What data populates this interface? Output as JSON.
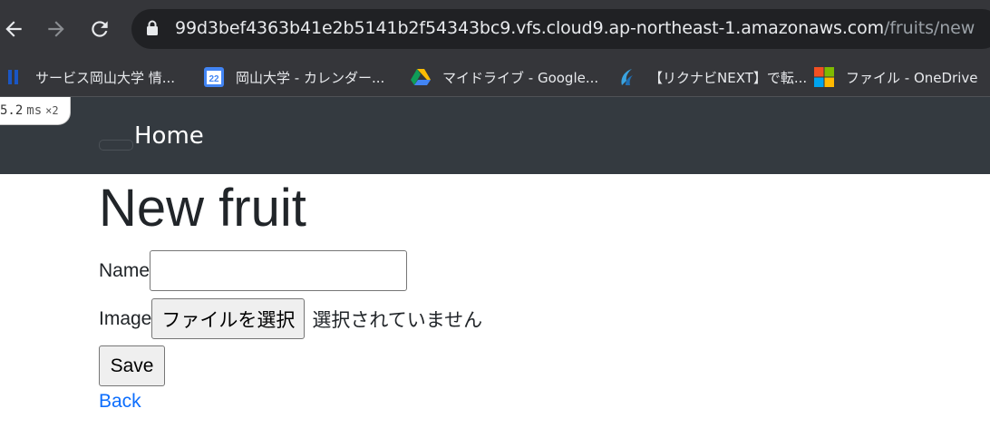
{
  "browser": {
    "url_host": "99d3bef4363b41e2b5141b2f54343bc9.vfs.cloud9.ap-northeast-1.amazonaws.com",
    "url_path": "/fruits/new",
    "bookmarks": [
      {
        "label": "サービス岡山大学 情...",
        "icon": "okayama-univ-icon"
      },
      {
        "label": "岡山大学 - カレンダー...",
        "icon": "google-calendar-icon",
        "icon_text": "22"
      },
      {
        "label": "マイドライブ - Google...",
        "icon": "google-drive-icon"
      },
      {
        "label": "【リクナビNEXT】で転...",
        "icon": "rikunabi-icon"
      },
      {
        "label": "ファイル - OneDrive",
        "icon": "microsoft-icon"
      }
    ]
  },
  "debug": {
    "time": "5.2",
    "unit": "ms",
    "count": "×2"
  },
  "navbar": {
    "home_label": "Home"
  },
  "page": {
    "title": "New fruit",
    "name_label": "Name",
    "name_value": "",
    "image_label": "Image",
    "file_button": "ファイルを選択",
    "file_status": "選択されていません",
    "save_label": "Save",
    "back_label": "Back"
  },
  "colors": {
    "navbar": "#343a40",
    "link": "#0d6efd",
    "browser_chrome": "#35363a"
  }
}
